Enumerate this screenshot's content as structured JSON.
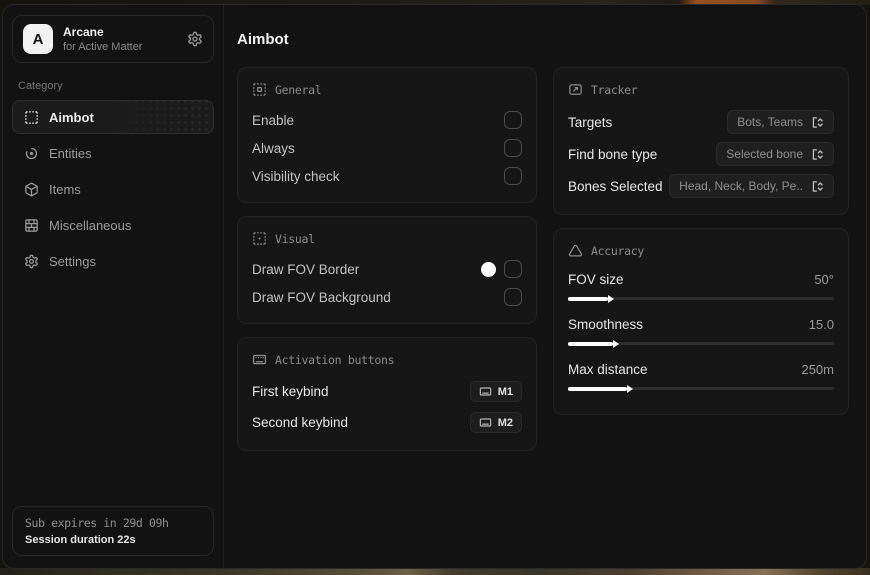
{
  "app": {
    "logo_letter": "A",
    "name": "Arcane",
    "tagline": "for Active Matter"
  },
  "sidebar": {
    "category_label": "Category",
    "items": [
      {
        "label": "Aimbot",
        "icon": "box-select-icon",
        "active": true
      },
      {
        "label": "Entities",
        "icon": "scan-eye-icon",
        "active": false
      },
      {
        "label": "Items",
        "icon": "package-icon",
        "active": false
      },
      {
        "label": "Miscellaneous",
        "icon": "brick-wall-icon",
        "active": false
      },
      {
        "label": "Settings",
        "icon": "gear-icon",
        "active": false
      }
    ],
    "footer": {
      "sub_expiry": "Sub expires in 29d 09h",
      "session": "Session duration 22s"
    }
  },
  "main": {
    "title": "Aimbot",
    "general": {
      "title": "General",
      "rows": [
        {
          "label": "Enable",
          "checked": false
        },
        {
          "label": "Always",
          "checked": false
        },
        {
          "label": "Visibility check",
          "checked": false
        }
      ]
    },
    "visual": {
      "title": "Visual",
      "rows": [
        {
          "label": "Draw FOV Border",
          "swatch": "#ffffff",
          "checked": false
        },
        {
          "label": "Draw FOV Background",
          "checked": false
        }
      ]
    },
    "activation": {
      "title": "Activation buttons",
      "rows": [
        {
          "label": "First keybind",
          "key": "M1"
        },
        {
          "label": "Second keybind",
          "key": "M2"
        }
      ]
    },
    "tracker": {
      "title": "Tracker",
      "rows": [
        {
          "label": "Targets",
          "value": "Bots, Teams"
        },
        {
          "label": "Find bone type",
          "value": "Selected bone"
        },
        {
          "label": "Bones Selected",
          "value": "Head, Neck, Body, Pe.."
        }
      ]
    },
    "accuracy": {
      "title": "Accuracy",
      "rows": [
        {
          "label": "FOV size",
          "value": "50°",
          "percent": 15
        },
        {
          "label": "Smoothness",
          "value": "15.0",
          "percent": 17
        },
        {
          "label": "Max distance",
          "value": "250m",
          "percent": 22
        }
      ]
    }
  },
  "colors": {
    "window_bg": "#121212",
    "card_bg": "#161616",
    "accent": "#ffffff",
    "fov_swatch": "#ffffff"
  }
}
